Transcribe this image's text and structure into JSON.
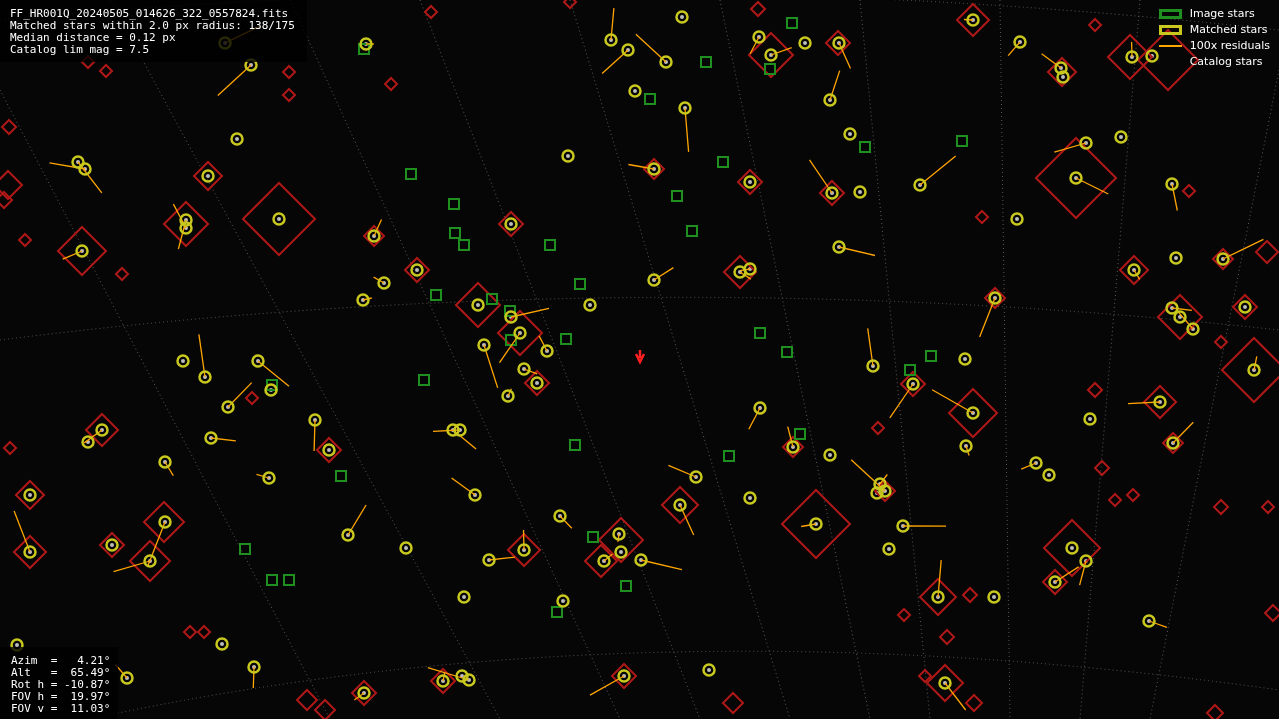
{
  "file_info": [
    "FF_HR001Q_20240505_014626_322_0557824.fits",
    "Matched stars within 2.0 px radius: 138/175",
    "Median distance = 0.12 px",
    "Catalog lim mag = 7.5"
  ],
  "legend": [
    {
      "kind": "box",
      "color": "#1f8f1f",
      "label": "Image stars"
    },
    {
      "kind": "box",
      "color": "#c8c81e",
      "label": "Matched stars"
    },
    {
      "kind": "line",
      "color": "#ffa500",
      "label": "100x residuals"
    },
    {
      "kind": "none",
      "label": "Catalog stars"
    }
  ],
  "pointing": [
    "Azim  =   4.21°",
    "Alt   =  65.49°",
    "Rot h = -10.87°",
    "FOV h =  19.97°",
    "FOV v =  11.03°"
  ]
}
